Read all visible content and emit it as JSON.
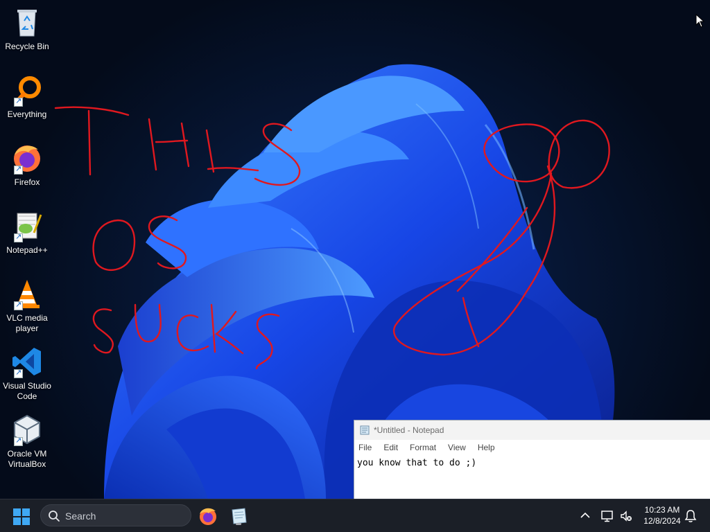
{
  "desktop": {
    "icons": [
      {
        "label": "Recycle Bin"
      },
      {
        "label": "Everything"
      },
      {
        "label": "Firefox"
      },
      {
        "label": "Notepad++"
      },
      {
        "label": "VLC media player"
      },
      {
        "label": "Visual Studio Code"
      },
      {
        "label": "Oracle VM VirtualBox"
      }
    ]
  },
  "notepad": {
    "title": "*Untitled - Notepad",
    "menu": [
      "File",
      "Edit",
      "Format",
      "View",
      "Help"
    ],
    "content": "you know that to do ;)"
  },
  "taskbar": {
    "search_label": "Search",
    "apps": [
      {
        "name": "Firefox",
        "icon": "firefox-icon"
      },
      {
        "name": "Notepad",
        "icon": "notepad-icon",
        "open": true
      }
    ],
    "clock": {
      "time": "10:23 AM",
      "date": "12/8/2024"
    }
  },
  "colors": {
    "scribble": "#e0181f",
    "taskbar": "#1b1f27",
    "wallpaper_accent": "#1f5bff"
  }
}
